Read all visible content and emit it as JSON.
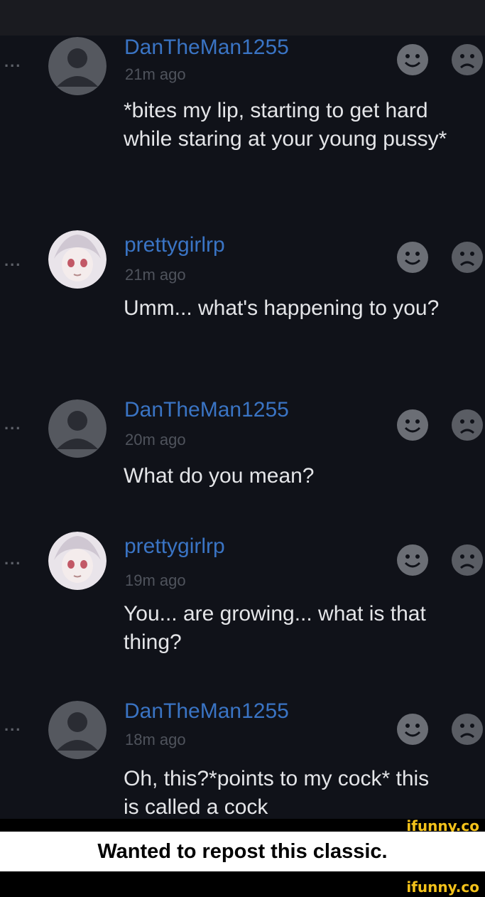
{
  "comments": [
    {
      "username": "DanTheMan1255",
      "time": "21m ago",
      "text": "*bites my lip, starting to get hard while staring at your young pussy*",
      "avatar": "default-avatar"
    },
    {
      "username": "prettygirlrp",
      "time": "21m ago",
      "text": "Umm... what's happening to you?",
      "avatar": "anime-avatar"
    },
    {
      "username": "DanTheMan1255",
      "time": "20m ago",
      "text": "What do you mean?",
      "avatar": "default-avatar"
    },
    {
      "username": "prettygirlrp",
      "time": "19m ago",
      "text": "You... are growing... what is that thing?",
      "avatar": "anime-avatar"
    },
    {
      "username": "DanTheMan1255",
      "time": "18m ago",
      "text": "Oh, this?*points to my cock* this is called a cock",
      "avatar": "default-avatar"
    }
  ],
  "ui": {
    "more_dots": "...",
    "caption": "Wanted to repost this classic.",
    "watermark": "ifunny.co"
  },
  "colors": {
    "background": "#101219",
    "username": "#3a74c4",
    "timestamp": "#4f535c",
    "text": "#e4e5e8",
    "watermark": "#f3c21b"
  }
}
